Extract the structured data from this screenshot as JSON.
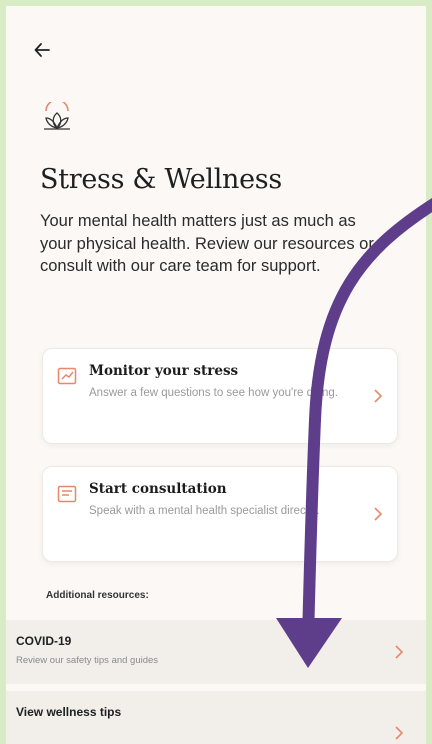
{
  "header": {
    "back_icon": "arrow-left-icon",
    "logo_icon": "lotus-icon"
  },
  "page": {
    "title": "Stress & Wellness",
    "description": "Your mental health matters just as much as your physical health. Review our resources or consult with our care team for support."
  },
  "cards": [
    {
      "icon": "chart-icon",
      "title": "Monitor your stress",
      "description": "Answer a few questions to see how you're doing."
    },
    {
      "icon": "chat-icon",
      "title": "Start consultation",
      "description": "Speak with a mental health specialist directly."
    }
  ],
  "section_label": "Additional resources:",
  "resources": [
    {
      "title": "COVID-19",
      "description": "Review our safety tips and guides"
    },
    {
      "title": "View wellness tips",
      "description": ""
    }
  ],
  "colors": {
    "accent": "#e8876b",
    "annotation": "#5e3e8a",
    "frame": "#d7ecc4"
  }
}
